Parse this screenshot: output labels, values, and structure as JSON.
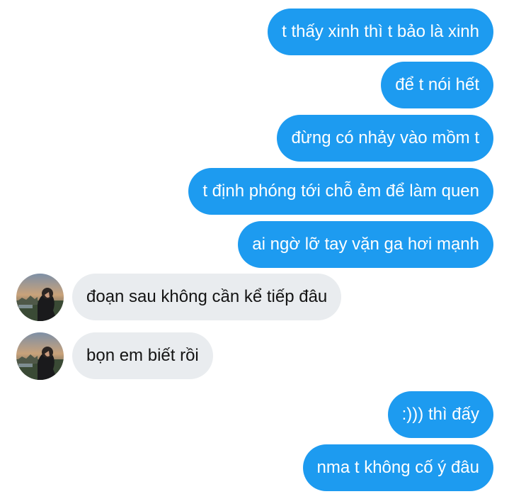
{
  "messages": [
    {
      "side": "out",
      "text": "t thấy xinh thì t bảo là xinh"
    },
    {
      "side": "out",
      "text": "để t nói hết"
    },
    {
      "side": "out",
      "text": "đừng có nhảy vào mồm t"
    },
    {
      "side": "out",
      "text": "t định phóng tới chỗ ẻm để làm quen"
    },
    {
      "side": "out",
      "text": "ai ngờ lỡ tay vặn ga hơi mạnh"
    },
    {
      "side": "in",
      "text": "đoạn sau không cần kể tiếp đâu"
    },
    {
      "side": "in",
      "text": "bọn em biết rồi"
    },
    {
      "side": "out",
      "text": ":))) thì đấy"
    },
    {
      "side": "out",
      "text": "nma t không cố ý đâu"
    }
  ],
  "colors": {
    "outgoing_bubble": "#1d9bf0",
    "incoming_bubble": "#e9ecef",
    "outgoing_text": "#ffffff",
    "incoming_text": "#141414"
  },
  "avatar_icon": "sunset-portrait-photo"
}
